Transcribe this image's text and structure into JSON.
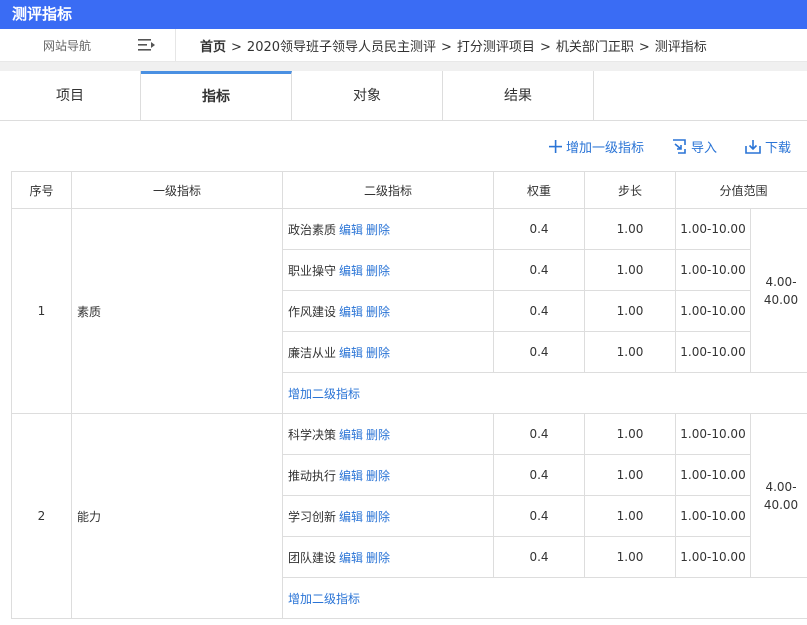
{
  "app_title": "测评指标",
  "nav": {
    "site_nav_label": "网站导航",
    "breadcrumb": [
      "首页",
      "2020领导班子领导人员民主测评",
      "打分测评项目",
      "机关部门正职",
      "测评指标"
    ],
    "separator": ">"
  },
  "tabs": [
    {
      "label": "项目"
    },
    {
      "label": "指标"
    },
    {
      "label": "对象"
    },
    {
      "label": "结果"
    }
  ],
  "active_tab": "指标",
  "toolbar": {
    "add_label": "增加一级指标",
    "import_label": "导入",
    "download_label": "下载"
  },
  "table": {
    "headers": [
      "序号",
      "一级指标",
      "二级指标",
      "权重",
      "步长",
      "分值范围"
    ],
    "edit_label": "编辑",
    "delete_label": "删除",
    "add_sub_label": "增加二级指标",
    "groups": [
      {
        "index": "1",
        "name": "素质",
        "total_range": "4.00-\n40.00",
        "rows": [
          {
            "name": "政治素质",
            "weight": "0.4",
            "step": "1.00",
            "range": "1.00-10.00"
          },
          {
            "name": "职业操守",
            "weight": "0.4",
            "step": "1.00",
            "range": "1.00-10.00"
          },
          {
            "name": "作风建设",
            "weight": "0.4",
            "step": "1.00",
            "range": "1.00-10.00"
          },
          {
            "name": "廉洁从业",
            "weight": "0.4",
            "step": "1.00",
            "range": "1.00-10.00"
          }
        ]
      },
      {
        "index": "2",
        "name": "能力",
        "total_range": "4.00-\n40.00",
        "rows": [
          {
            "name": "科学决策",
            "weight": "0.4",
            "step": "1.00",
            "range": "1.00-10.00"
          },
          {
            "name": "推动执行",
            "weight": "0.4",
            "step": "1.00",
            "range": "1.00-10.00"
          },
          {
            "name": "学习创新",
            "weight": "0.4",
            "step": "1.00",
            "range": "1.00-10.00"
          },
          {
            "name": "团队建设",
            "weight": "0.4",
            "step": "1.00",
            "range": "1.00-10.00"
          }
        ]
      }
    ]
  },
  "colors": {
    "topbar": "#3a6cf4",
    "link": "#2a74d6",
    "active_tab_border": "#4a90e2"
  }
}
